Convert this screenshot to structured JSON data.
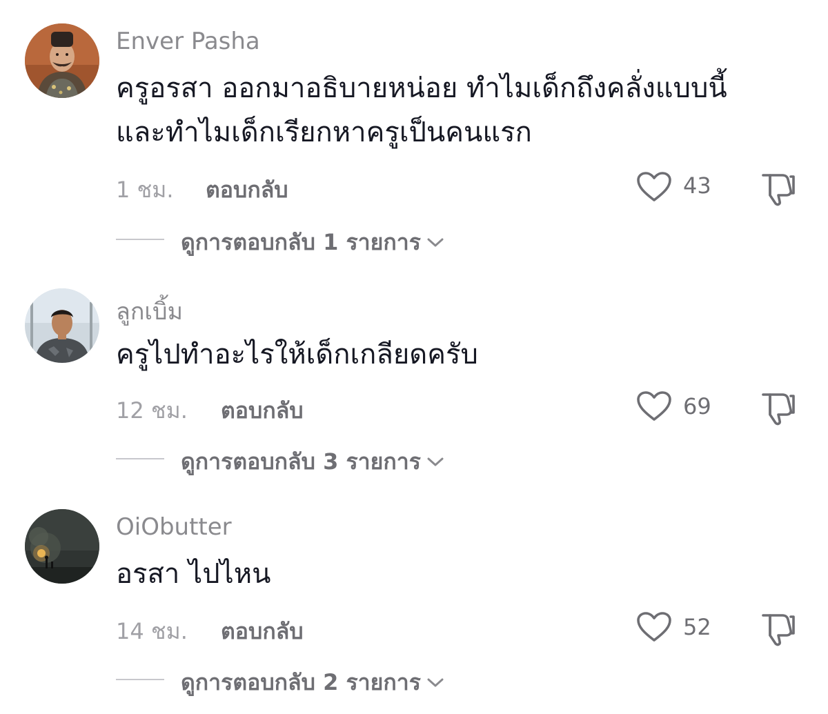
{
  "comments": [
    {
      "username": "Enver Pasha",
      "text_lines": [
        "ครูอรสา ออกมาอธิบายหน่อย ทำไมเด็กถึงคลั่งแบบนี้",
        "และทำไมเด็กเรียกหาครูเป็นคนแรก"
      ],
      "time": "1 ชม.",
      "reply_label": "ตอบกลับ",
      "likes": "43",
      "view_replies": "ดูการตอบกลับ 1 รายการ",
      "avatar_icon": "portrait-officer-avatar"
    },
    {
      "username": "ลูกเบิ้ม",
      "text_lines": [
        "ครูไปทำอะไรให้เด็กเกลียดครับ"
      ],
      "time": "12 ชม.",
      "reply_label": "ตอบกลับ",
      "likes": "69",
      "view_replies": "ดูการตอบกลับ 3 รายการ",
      "avatar_icon": "young-man-avatar"
    },
    {
      "username": "OiObutter",
      "text_lines": [
        "อรสา ไปไหน"
      ],
      "time": "14 ชม.",
      "reply_label": "ตอบกลับ",
      "likes": "52",
      "view_replies": "ดูการตอบกลับ 2 รายการ",
      "avatar_icon": "night-scene-avatar"
    }
  ],
  "icons": {
    "like": "heart-outline-icon",
    "dislike": "thumbs-down-icon",
    "expand": "chevron-down-icon"
  },
  "colors": {
    "username": "#8a8a8e",
    "text": "#161823",
    "meta": "#a0a0a5",
    "action": "#6e6e73"
  }
}
